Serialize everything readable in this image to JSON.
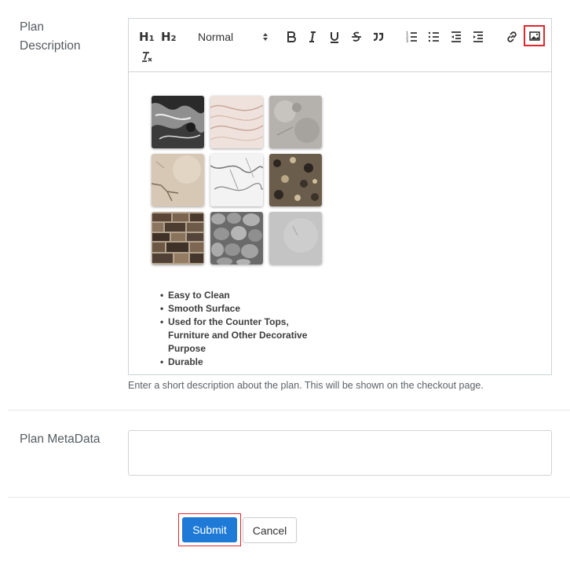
{
  "plan_description": {
    "label": "Plan Description",
    "hint": "Enter a short description about the plan. This will be shown on the checkout page.",
    "toolbar": {
      "h1": "H",
      "h1_sub": "1",
      "h2": "H",
      "h2_sub": "2",
      "format_select": "Normal",
      "icons": [
        "bold-icon",
        "italic-icon",
        "underline-icon",
        "strikethrough-icon",
        "blockquote-icon",
        "ordered-list-icon",
        "bullet-list-icon",
        "outdent-icon",
        "indent-icon",
        "link-icon",
        "image-icon",
        "clear-format-icon"
      ]
    },
    "content": {
      "tiles": [
        "black-marble",
        "pink-wave-marble",
        "grey-stone",
        "beige-cracked",
        "white-marble",
        "brown-granite",
        "stone-brick",
        "grey-pebble",
        "grey-concrete"
      ],
      "bullets": [
        "Easy to Clean",
        "Smooth Surface",
        "Used for the Counter Tops, Furniture and Other Decorative Purpose",
        "Durable"
      ]
    }
  },
  "plan_metadata": {
    "label": "Plan MetaData",
    "value": ""
  },
  "actions": {
    "submit": "Submit",
    "cancel": "Cancel"
  },
  "colors": {
    "accent": "#1e7ad6",
    "highlight": "#e0262f"
  }
}
